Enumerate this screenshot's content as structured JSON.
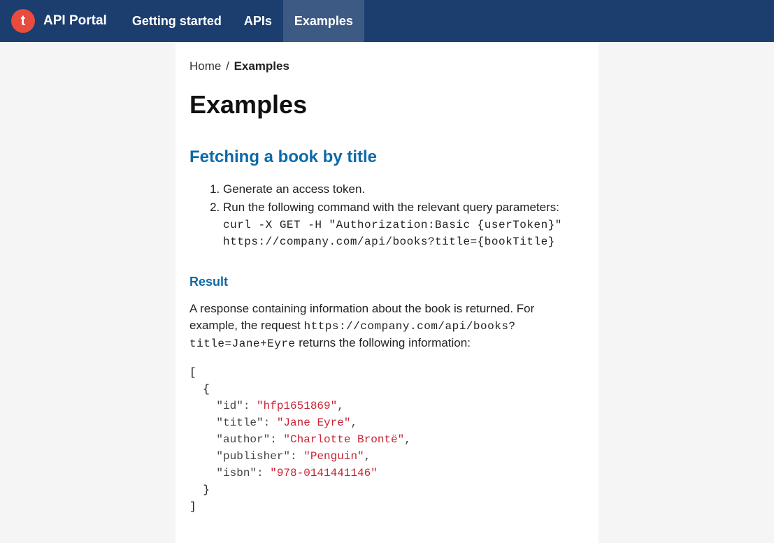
{
  "navbar": {
    "logo_letter": "t",
    "logo_text": "API Portal",
    "items": [
      {
        "label": "Getting started",
        "active": false
      },
      {
        "label": "APIs",
        "active": false
      },
      {
        "label": "Examples",
        "active": true
      }
    ]
  },
  "breadcrumb": {
    "home": "Home",
    "separator": "/",
    "current": "Examples"
  },
  "page": {
    "title": "Examples"
  },
  "section": {
    "title": "Fetching a book by title",
    "step1": "Generate an access token.",
    "step2_prefix": "Run the following command with the relevant query parameters: ",
    "step2_code": "curl -X GET -H \"Authorization:Basic {userToken}\" https://company.com/api/books?title={bookTitle}"
  },
  "result": {
    "title": "Result",
    "text_prefix": "A response containing information about the book is returned. For example, the request ",
    "text_code": "https://company.com/api/books?title=Jane+Eyre",
    "text_suffix": " returns the following information:",
    "json_data": {
      "id_key": "\"id\"",
      "id_val": "\"hfp1651869\"",
      "title_key": "\"title\"",
      "title_val": "\"Jane Eyre\"",
      "author_key": "\"author\"",
      "author_val": "\"Charlotte Brontë\"",
      "publisher_key": "\"publisher\"",
      "publisher_val": "\"Penguin\"",
      "isbn_key": "\"isbn\"",
      "isbn_val": "\"978-0141441146\""
    }
  }
}
